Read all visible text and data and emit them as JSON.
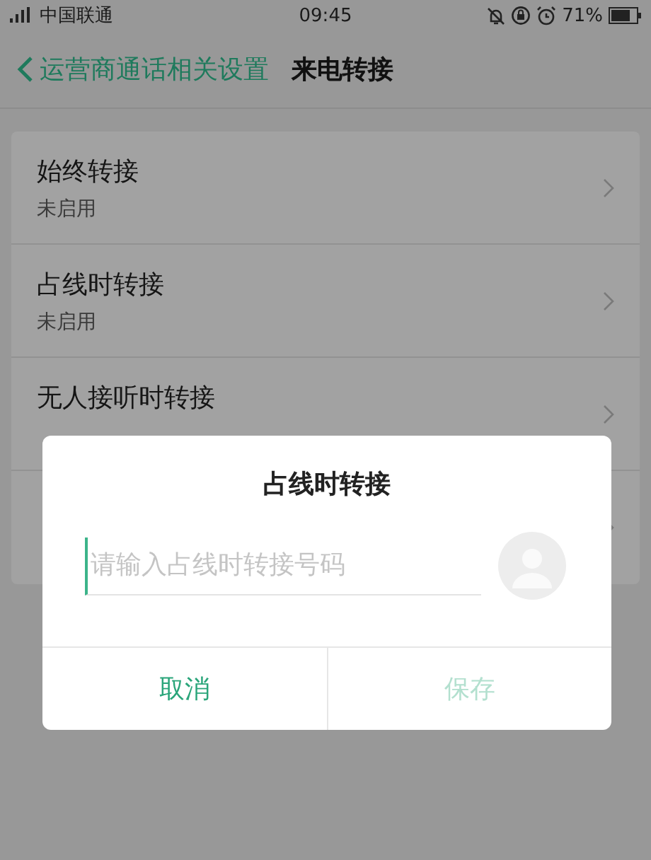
{
  "status_bar": {
    "carrier": "中国联通",
    "time": "09:45",
    "battery": "71%"
  },
  "header": {
    "back_label": "运营商通话相关设置",
    "title": "来电转接"
  },
  "items": [
    {
      "kind": "setting",
      "title": "始终转接",
      "subtitle": "未启用"
    },
    {
      "kind": "setting",
      "title": "占线时转接",
      "subtitle": "未启用"
    },
    {
      "kind": "setting",
      "title": "无人接听时转接"
    },
    {
      "kind": "setting"
    }
  ],
  "dialog": {
    "title": "占线时转接",
    "input": {
      "placeholder": "请输入占线时转接号码"
    },
    "buttons": [
      {
        "label": "取消",
        "disabled": false
      },
      {
        "label": "保存",
        "disabled": true
      }
    ]
  }
}
